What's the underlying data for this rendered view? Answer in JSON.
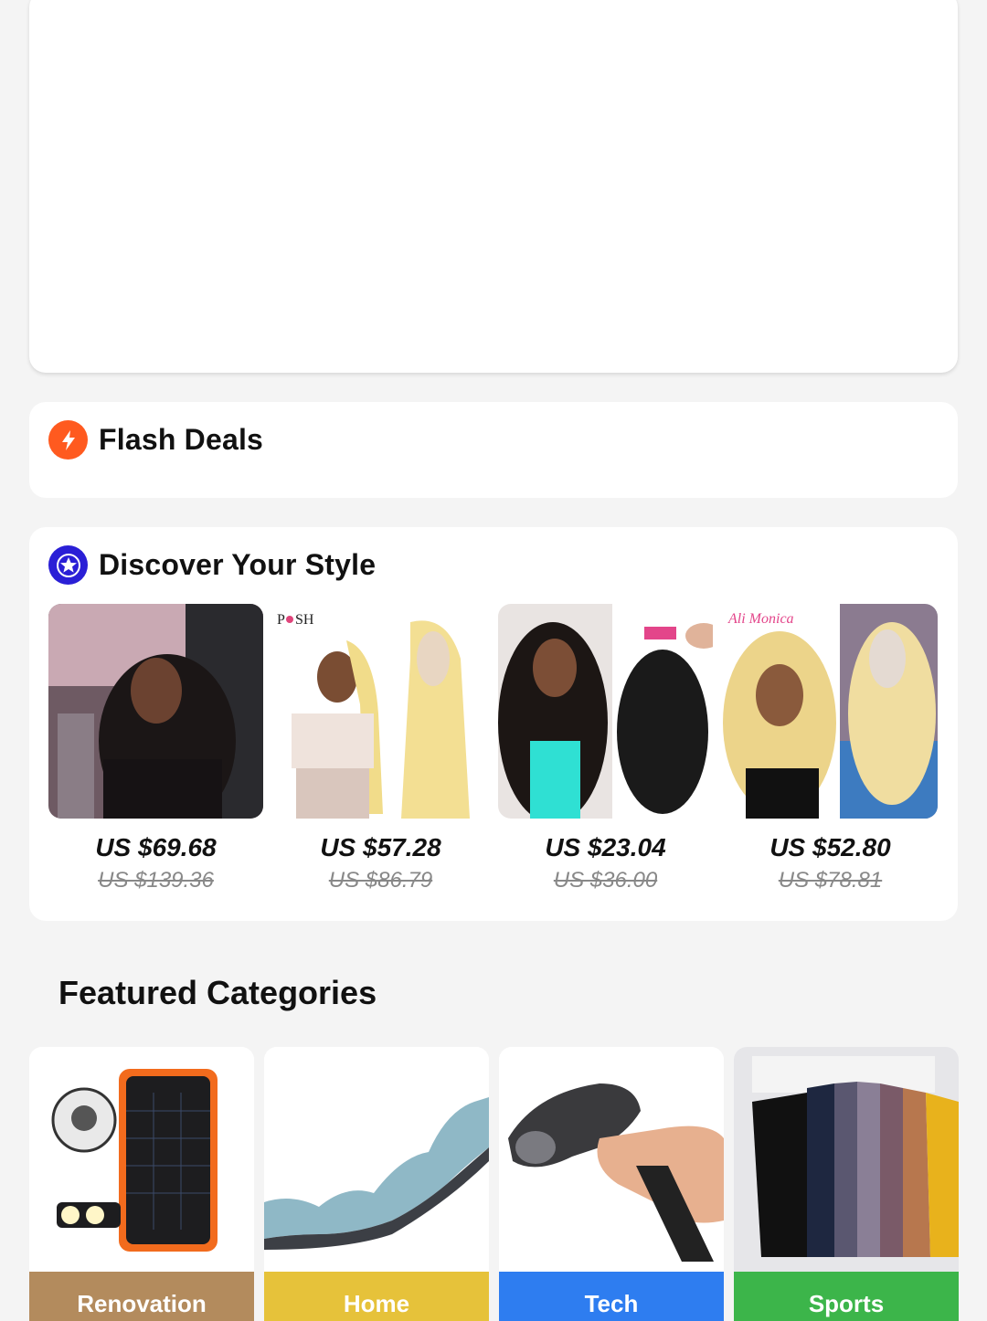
{
  "flash_deals": {
    "title": "Flash Deals",
    "icon": "lightning-icon",
    "icon_color": "#ff5a1f"
  },
  "discover": {
    "title": "Discover Your Style",
    "icon": "star-badge-icon",
    "icon_color": "#2a1fd6",
    "products": [
      {
        "price": "US $69.68",
        "old_price": "US $139.36"
      },
      {
        "price": "US $57.28",
        "old_price": "US $86.79",
        "brand": "PoSH"
      },
      {
        "price": "US $23.04",
        "old_price": "US $36.00"
      },
      {
        "price": "US $52.80",
        "old_price": "US $78.81",
        "brand": "Ali Monica"
      }
    ]
  },
  "featured": {
    "title": "Featured Categories",
    "categories": [
      {
        "label": "Renovation",
        "color": "#b38b5d"
      },
      {
        "label": "Home",
        "color": "#e6c23a"
      },
      {
        "label": "Tech",
        "color": "#2e7df0"
      },
      {
        "label": "Sports",
        "color": "#3cb54a"
      }
    ]
  }
}
